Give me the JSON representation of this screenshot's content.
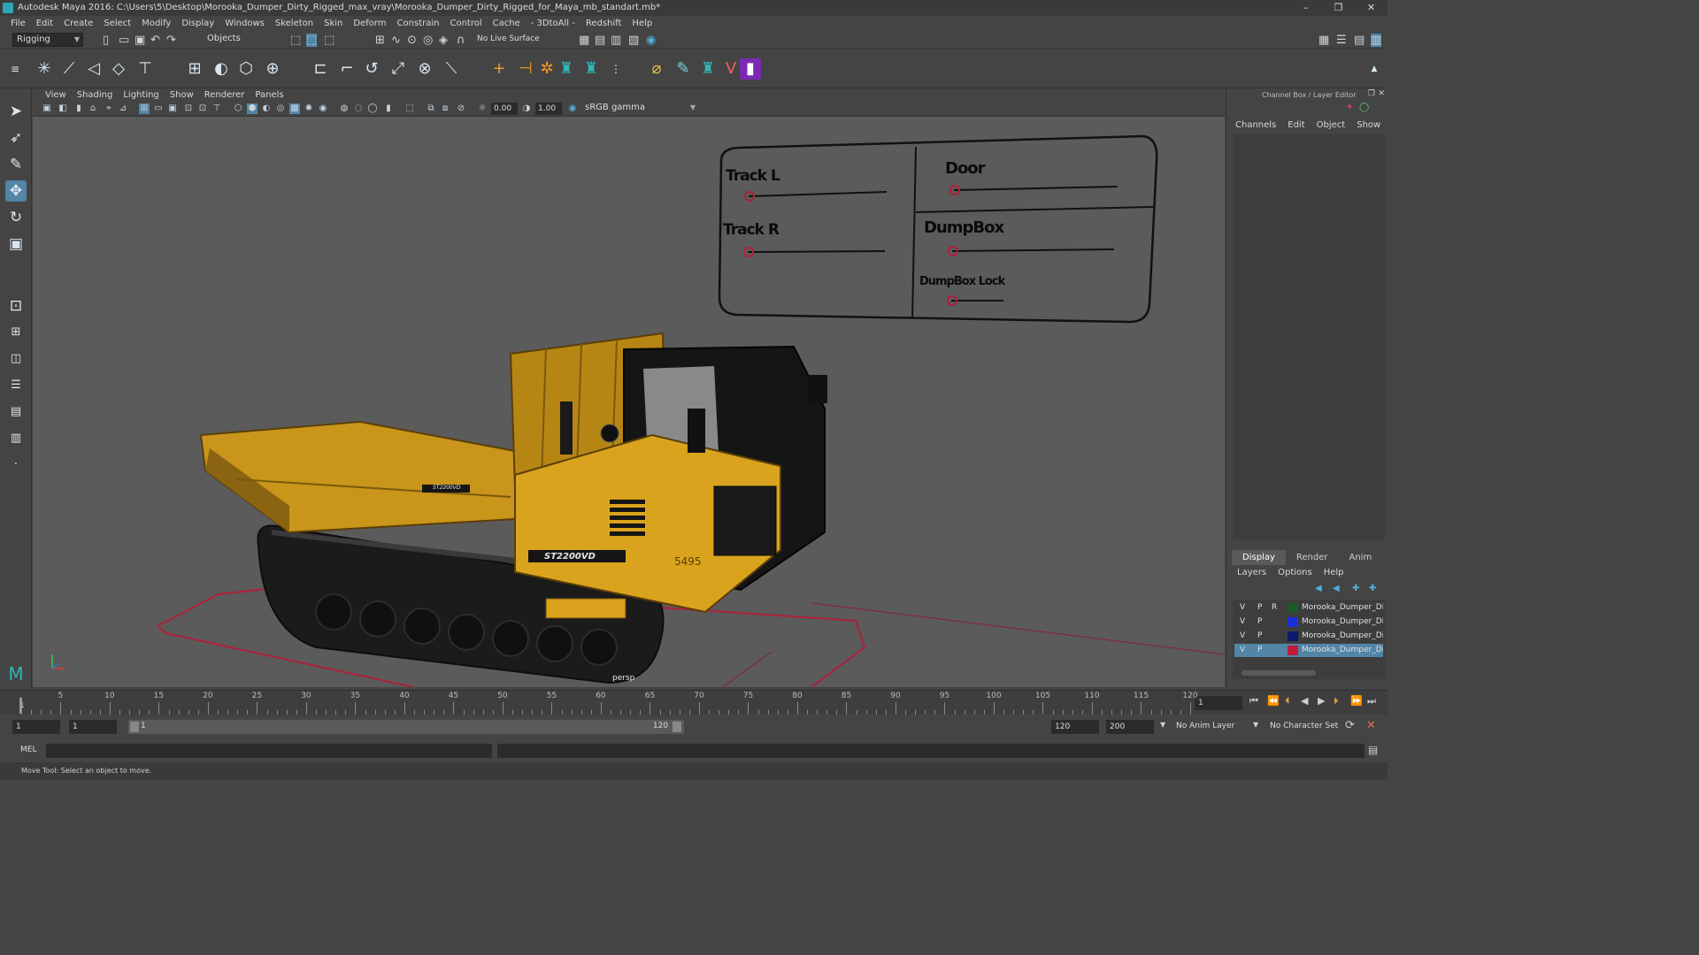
{
  "window": {
    "title": "Autodesk Maya 2016: C:\\Users\\5\\Desktop\\Morooka_Dumper_Dirty_Rigged_max_vray\\Morooka_Dumper_Dirty_Rigged_for_Maya_mb_standart.mb*",
    "minimize": "–",
    "restore": "❐",
    "close": "✕"
  },
  "menubar": [
    "File",
    "Edit",
    "Create",
    "Select",
    "Modify",
    "Display",
    "Windows",
    "Skeleton",
    "Skin",
    "Deform",
    "Constrain",
    "Control",
    "Cache",
    "- 3DtoAll -",
    "Redshift",
    "Help"
  ],
  "status": {
    "menuset": "Rigging",
    "selection_mode": "Objects",
    "live_surface": "No Live Surface"
  },
  "panel_menu": [
    "View",
    "Shading",
    "Lighting",
    "Show",
    "Renderer",
    "Panels"
  ],
  "panel_toolbar": {
    "exposure": "0.00",
    "gamma": "1.00",
    "colorspace": "sRGB gamma"
  },
  "viewport": {
    "camera_label": "persp",
    "controls": {
      "track_l": "Track L",
      "track_r": "Track R",
      "door": "Door",
      "dumpbox": "DumpBox",
      "dumpbox_lock": "DumpBox Lock"
    },
    "truck_text": {
      "model_badge": "ST2200VD",
      "model_badge_small": "ST2200VD",
      "number": "5495"
    }
  },
  "channel_box": {
    "title": "Channel Box / Layer Editor",
    "menu": [
      "Channels",
      "Edit",
      "Object",
      "Show"
    ]
  },
  "layer_editor": {
    "tabs": [
      "Display",
      "Render",
      "Anim"
    ],
    "active_tab": "Display",
    "menu": [
      "Layers",
      "Options",
      "Help"
    ],
    "layers": [
      {
        "v": "V",
        "p": "P",
        "r": "R",
        "color": "#1f5a2a",
        "name": "Morooka_Dumper_Dirty"
      },
      {
        "v": "V",
        "p": "P",
        "r": "",
        "color": "#1a2fd6",
        "name": "Morooka_Dumper_Dir"
      },
      {
        "v": "V",
        "p": "P",
        "r": "",
        "color": "#0c1a6e",
        "name": "Morooka_Dumper_Dir"
      },
      {
        "v": "V",
        "p": "P",
        "r": "",
        "color": "#c21a3a",
        "name": "Morooka_Dumper_Dir"
      }
    ],
    "selected_index": 3
  },
  "timeline": {
    "labels": [
      "5",
      "10",
      "15",
      "20",
      "25",
      "30",
      "35",
      "40",
      "45",
      "50",
      "55",
      "60",
      "65",
      "70",
      "75",
      "80",
      "85",
      "90",
      "95",
      "100",
      "105",
      "110",
      "115",
      "120"
    ],
    "current_frame_label": "1",
    "current_frame_field": "1"
  },
  "range": {
    "start": "1",
    "playback_start": "1",
    "slider_start": "1",
    "slider_end": "120",
    "playback_end": "120",
    "end": "200",
    "anim_layer": "No Anim Layer",
    "character_set": "No Character Set"
  },
  "command_line": {
    "label": "MEL"
  },
  "help_line": {
    "text": "Move Tool: Select an object to move."
  }
}
